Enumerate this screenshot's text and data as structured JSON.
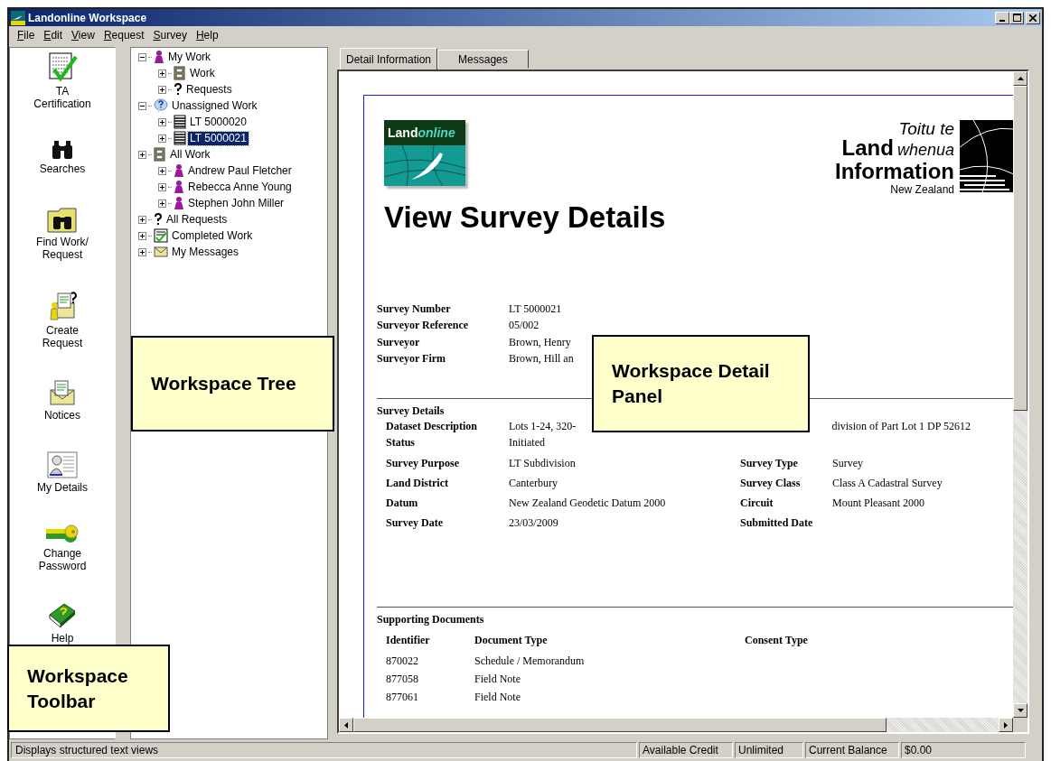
{
  "window": {
    "title": "Landonline Workspace"
  },
  "menu": [
    "File",
    "Edit",
    "View",
    "Request",
    "Survey",
    "Help"
  ],
  "toolbar": [
    {
      "kind": "certificate",
      "lines": [
        "TA",
        "Certification"
      ]
    },
    {
      "kind": "binoculars",
      "lines": [
        "Searches"
      ]
    },
    {
      "kind": "folder",
      "lines": [
        "Find Work/",
        "Request"
      ]
    },
    {
      "kind": "request",
      "lines": [
        "Create",
        "Request"
      ]
    },
    {
      "kind": "envelope",
      "lines": [
        "Notices"
      ]
    },
    {
      "kind": "details",
      "lines": [
        "My Details"
      ]
    },
    {
      "kind": "key",
      "lines": [
        "Change",
        "Password"
      ]
    },
    {
      "kind": "book",
      "lines": [
        "Help"
      ]
    }
  ],
  "tree": [
    {
      "label": "My Work",
      "kind": "person",
      "expanded": true,
      "selected": false,
      "children": [
        {
          "label": "Work",
          "kind": "cabinet",
          "expanded": false,
          "selected": false
        },
        {
          "label": "Requests",
          "kind": "question",
          "expanded": false,
          "selected": false
        }
      ]
    },
    {
      "label": "Unassigned Work",
      "kind": "bubble",
      "expanded": true,
      "selected": false,
      "children": [
        {
          "label": "LT 5000020",
          "kind": "document",
          "expanded": false,
          "selected": false
        },
        {
          "label": "LT 5000021",
          "kind": "document",
          "expanded": false,
          "selected": true
        }
      ]
    },
    {
      "label": "All Work",
      "kind": "cabinet",
      "expanded": false,
      "selected": false,
      "children": [
        {
          "label": "Andrew Paul Fletcher",
          "kind": "person",
          "expanded": false,
          "selected": false
        },
        {
          "label": "Rebecca Anne Young",
          "kind": "person",
          "expanded": false,
          "selected": false
        },
        {
          "label": "Stephen John Miller",
          "kind": "person",
          "expanded": false,
          "selected": false
        }
      ]
    },
    {
      "label": "All Requests",
      "kind": "question",
      "expanded": false,
      "selected": false
    },
    {
      "label": "Completed Work",
      "kind": "check",
      "expanded": false,
      "selected": false
    },
    {
      "label": "My Messages",
      "kind": "envelope",
      "expanded": false,
      "selected": false
    }
  ],
  "tabs": [
    {
      "label": "Detail Information",
      "selected": true
    },
    {
      "label": "Messages",
      "selected": false
    }
  ],
  "detail": {
    "logo_left": {
      "land": "Land",
      "online": "online"
    },
    "logo_right": {
      "line_1": "Toitu te",
      "land": "Land",
      "whenua": "whenua",
      "information": "Information",
      "country": "New Zealand"
    },
    "title": "View Survey Details",
    "summary": [
      {
        "label": "Survey Number",
        "value": "LT 5000021"
      },
      {
        "label": "Surveyor Reference",
        "value": "05/002"
      },
      {
        "label": "Surveyor",
        "value": "Brown, Henry"
      },
      {
        "label": "Surveyor Firm",
        "value": "Brown, Hill an"
      }
    ],
    "survey_details": {
      "heading": "Survey Details",
      "description": {
        "label": "Dataset Description",
        "value_parts": [
          "Lots 1-24, 320-",
          "division of Part Lot 1 DP 52612"
        ]
      },
      "status": {
        "label": "Status",
        "value": "Initiated"
      },
      "rows": [
        {
          "label": "Survey Purpose",
          "value": "LT Subdivision",
          "label_2": "Survey Type",
          "value_2": "Survey"
        },
        {
          "label": "Land District",
          "value": "Canterbury",
          "label_2": "Survey Class",
          "value_2": "Class A Cadastral Survey"
        },
        {
          "label": "Datum",
          "value": "New Zealand Geodetic Datum 2000",
          "label_2": "Circuit",
          "value_2": "Mount Pleasant 2000"
        },
        {
          "label": "Survey Date",
          "value": "23/03/2009",
          "label_2": "Submitted Date"
        }
      ]
    },
    "supporting_documents": {
      "heading": "Supporting Documents",
      "columns": [
        "Identifier",
        "Document Type",
        "Consent Type"
      ],
      "rows": [
        [
          "870022",
          "Schedule / Memorandum"
        ],
        [
          "877058",
          "Field Note"
        ],
        [
          "877061",
          "Field Note"
        ]
      ]
    }
  },
  "callouts": [
    {
      "kind": "tree",
      "text": "Workspace Tree"
    },
    {
      "kind": "detail",
      "text": "Workspace Detail Panel"
    },
    {
      "kind": "toolbar",
      "text": "Workspace Toolbar"
    }
  ],
  "status_bar": {
    "message": "Displays structured text views",
    "fields": [
      "Available Credit",
      "Unlimited",
      "Current Balance",
      "$0.00"
    ]
  }
}
